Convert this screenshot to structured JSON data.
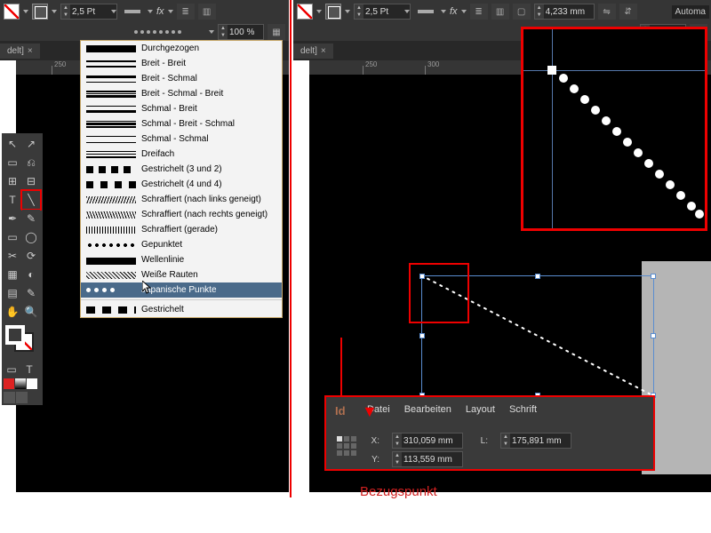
{
  "top_toolbar": {
    "stroke_weight": "2,5 Pt",
    "fx": "fx",
    "opacity": "100 %",
    "width_mm": "4,233 mm",
    "autom": "Automa"
  },
  "tab": {
    "label": "delt]"
  },
  "ruler": {
    "a": "250",
    "b": "300",
    "c": "250",
    "d": "300"
  },
  "tools": {
    "arrow": "↖",
    "direct": "↗",
    "page": "▭",
    "gap": "⎌",
    "type": "T",
    "line": "╲",
    "pen": "✒",
    "pencil": "✎",
    "rect": "▭",
    "ellipse": "◯",
    "scissors": "✂",
    "rotate": "⟳",
    "scale": "⤢",
    "shear": "⬔",
    "grad": "▦",
    "eyedrop": "✎",
    "hand": "✋",
    "zoom": "🔍",
    "note": "▤",
    "tchain": "T"
  },
  "stroke_styles": {
    "i0": "Durchgezogen",
    "i1": "Breit - Breit",
    "i2": "Breit - Schmal",
    "i3": "Breit - Schmal - Breit",
    "i4": "Schmal - Breit",
    "i5": "Schmal - Breit - Schmal",
    "i6": "Schmal - Schmal",
    "i7": "Dreifach",
    "i8": "Gestrichelt (3 und 2)",
    "i9": "Gestrichelt (4 und 4)",
    "i10": "Schraffiert (nach links geneigt)",
    "i11": "Schraffiert (nach rechts geneigt)",
    "i12": "Schraffiert (gerade)",
    "i13": "Gepunktet",
    "i14": "Wellenlinie",
    "i15": "Weiße Rauten",
    "i16": "Japanische Punkte",
    "i17": "Gestrichelt"
  },
  "info": {
    "menu": {
      "m0": "Datei",
      "m1": "Bearbeiten",
      "m2": "Layout",
      "m3": "Schrift"
    },
    "id": "Id",
    "x_label": "X:",
    "y_label": "Y:",
    "l_label": "L:",
    "x": "310,059 mm",
    "y": "113,559 mm",
    "l": "175,891 mm"
  },
  "caption": "Bezugspunkt"
}
